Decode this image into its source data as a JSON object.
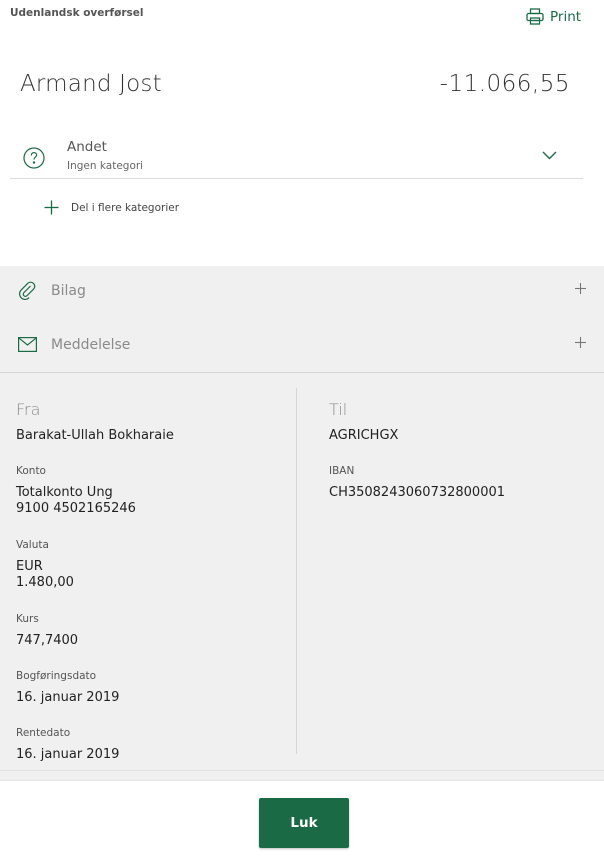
{
  "header": {
    "subtitle": "Udenlandsk overførsel",
    "print_label": "Print",
    "print_icon": "printer-icon"
  },
  "transaction": {
    "name": "Armand Jost",
    "amount": "-11.066,55"
  },
  "category": {
    "title": "Andet",
    "subtitle": "Ingen kategori",
    "icon": "question-circle-icon",
    "split_label": "Del i flere kategorier"
  },
  "accordions": [
    {
      "label": "Bilag",
      "icon": "paperclip-icon"
    },
    {
      "label": "Meddelelse",
      "icon": "envelope-icon"
    }
  ],
  "from": {
    "heading": "Fra",
    "name": "Barakat-Ullah Bokharaie",
    "account_label": "Konto",
    "account_name": "Totalkonto Ung",
    "account_number": "9100 4502165246",
    "currency_label": "Valuta",
    "currency": "EUR",
    "currency_amount": "1.480,00",
    "rate_label": "Kurs",
    "rate": "747,7400",
    "booking_label": "Bogføringsdato",
    "booking_date": "16. januar 2019",
    "interest_label": "Rentedato",
    "interest_date": "16. januar 2019"
  },
  "to": {
    "heading": "Til",
    "bic": "AGRICHGX",
    "iban_label": "IBAN",
    "iban": "CH3508243060732800001"
  },
  "footer": {
    "close_label": "Luk"
  },
  "colors": {
    "accent": "#1a6b45",
    "panel_bg": "#f0f0f0"
  }
}
